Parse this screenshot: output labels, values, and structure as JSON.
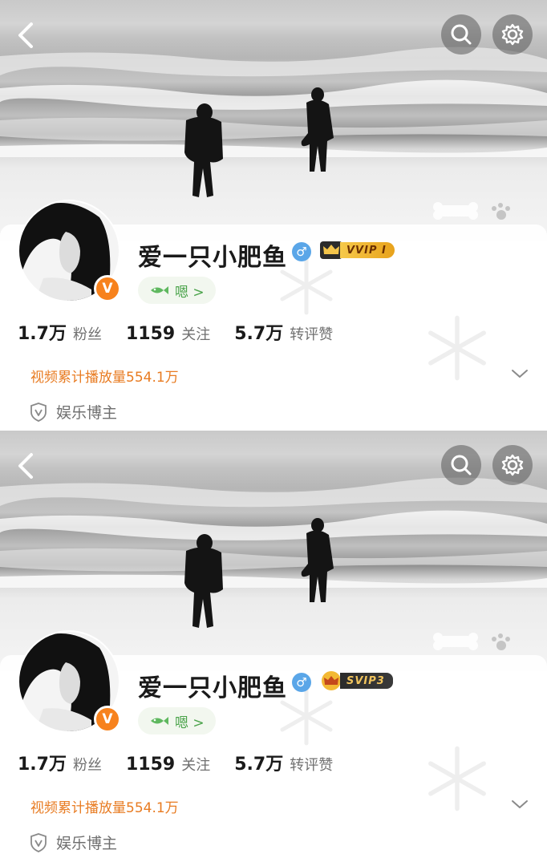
{
  "panels": [
    {
      "profile": {
        "name": "爱一只小肥鱼",
        "gender_symbol": "♂",
        "vip_label": "VVIP I",
        "vip_style": "gold",
        "verified_badge": "V",
        "mood_text": "嗯 >"
      },
      "stats": [
        {
          "value": "1.7万",
          "label": "粉丝"
        },
        {
          "value": "1159",
          "label": "关注"
        },
        {
          "value": "5.7万",
          "label": "转评赞"
        }
      ],
      "video_playcount": "视频累计播放量554.1万",
      "category": "娱乐博主"
    },
    {
      "profile": {
        "name": "爱一只小肥鱼",
        "gender_symbol": "♂",
        "vip_label": "SVIP3",
        "vip_style": "dark",
        "verified_badge": "V",
        "mood_text": "嗯 >"
      },
      "stats": [
        {
          "value": "1.7万",
          "label": "粉丝"
        },
        {
          "value": "1159",
          "label": "关注"
        },
        {
          "value": "5.7万",
          "label": "转评赞"
        }
      ],
      "video_playcount": "视频累计播放量554.1万",
      "category": "娱乐博主"
    }
  ],
  "icons": {
    "back": "chevron-left-icon",
    "search": "search-icon",
    "settings": "gear-icon",
    "verified": "verified-v-icon",
    "gender": "male-icon",
    "mood": "fish-icon",
    "expand": "chevron-down-icon",
    "category": "shield-v-icon"
  },
  "colors": {
    "accent_orange": "#f7821d",
    "playcount_orange": "#e87b21",
    "gender_blue": "#5aa6e8",
    "vip_gold": "#f6c94a",
    "mood_green": "#4aa34a"
  }
}
